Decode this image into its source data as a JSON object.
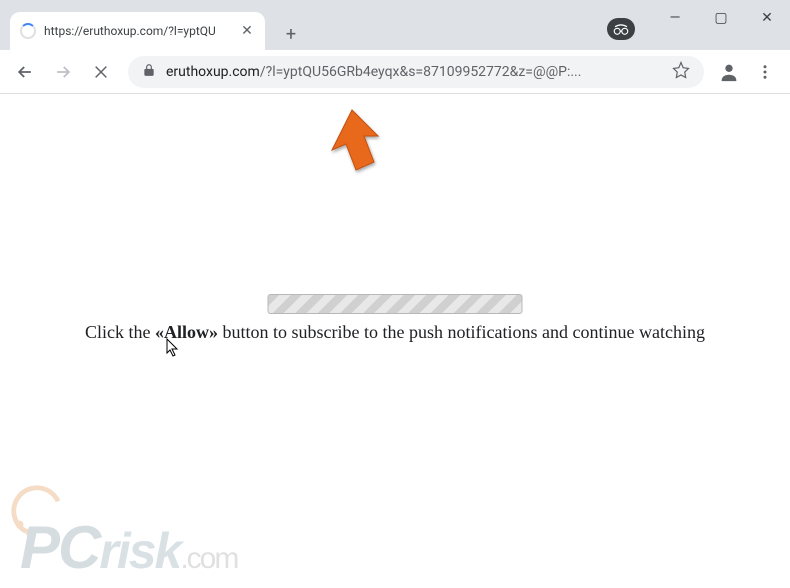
{
  "titlebar": {
    "tab_title": "https://eruthoxup.com/?l=yptQU",
    "new_tab_icon": "+",
    "close_icon": "✕"
  },
  "window": {
    "minimize": "—",
    "maximize": "▢",
    "close": "✕"
  },
  "toolbar": {
    "url_domain": "eruthoxup.com",
    "url_path": "/?l=yptQU56GRb4eyqx&s=87109952772&z=@@P:..."
  },
  "page": {
    "message_pre": "Click the ",
    "message_bold": "«Allow»",
    "message_post": " button to subscribe to the push notifications and continue watching"
  },
  "watermark": {
    "p": "P",
    "c": "C",
    "rest": "risk",
    "dotcom": ".com"
  }
}
